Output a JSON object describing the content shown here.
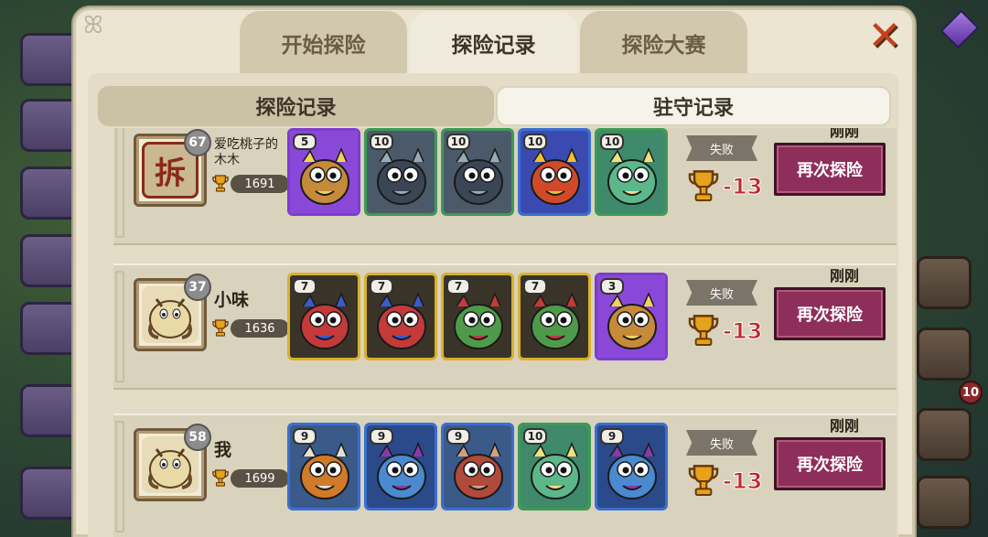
{
  "tabs": [
    "开始探险",
    "探险记录",
    "探险大赛"
  ],
  "active_tab": 1,
  "subtabs": [
    "探险记录",
    "驻守记录"
  ],
  "colors": {
    "retry_bg": "#8d2f5a",
    "score_red": "#c0282c",
    "border_purple": "#7b3ccf",
    "border_green": "#3d9a55",
    "border_blue": "#3a6fd0",
    "border_gold": "#d9b12b"
  },
  "background": {
    "badge": "10"
  },
  "records": [
    {
      "player": {
        "name": "爱吃桃子的木木",
        "level": "67",
        "trophies": "1691",
        "avatar_icon": "seal-icon",
        "avatar_glyph": "拆"
      },
      "team": [
        {
          "level": "5",
          "rarity": "purple",
          "creature": "owl-wizard"
        },
        {
          "level": "10",
          "rarity": "green",
          "creature": "dark-elephant"
        },
        {
          "level": "10",
          "rarity": "green",
          "creature": "dark-elephant"
        },
        {
          "level": "10",
          "rarity": "blue",
          "creature": "phoenix-bird"
        },
        {
          "level": "10",
          "rarity": "green",
          "creature": "green-frog"
        }
      ],
      "result": "失败",
      "delta": "-13",
      "time": "刚刚",
      "retry_label": "再次探险"
    },
    {
      "player": {
        "name": "小味",
        "level": "37",
        "trophies": "1636",
        "avatar_icon": "yeti-icon",
        "avatar_glyph": ""
      },
      "team": [
        {
          "level": "7",
          "rarity": "gold",
          "creature": "red-blue-dragon"
        },
        {
          "level": "7",
          "rarity": "gold",
          "creature": "red-blue-dragon"
        },
        {
          "level": "7",
          "rarity": "gold",
          "creature": "green-dragon"
        },
        {
          "level": "7",
          "rarity": "gold",
          "creature": "green-dragon"
        },
        {
          "level": "3",
          "rarity": "purple",
          "creature": "owl-wizard"
        }
      ],
      "result": "失败",
      "delta": "-13",
      "time": "刚刚",
      "retry_label": "再次探险"
    },
    {
      "player": {
        "name": "我",
        "level": "58",
        "trophies": "1699",
        "avatar_icon": "yeti-icon",
        "avatar_glyph": ""
      },
      "team": [
        {
          "level": "9",
          "rarity": "blue",
          "creature": "vulture-bird"
        },
        {
          "level": "9",
          "rarity": "blue",
          "creature": "blue-winged-beast"
        },
        {
          "level": "9",
          "rarity": "blue",
          "creature": "rock-golem"
        },
        {
          "level": "10",
          "rarity": "green",
          "creature": "green-frog"
        },
        {
          "level": "9",
          "rarity": "blue",
          "creature": "blue-winged-beast"
        }
      ],
      "result": "失败",
      "delta": "-13",
      "time": "刚刚",
      "retry_label": "再次探险"
    }
  ]
}
